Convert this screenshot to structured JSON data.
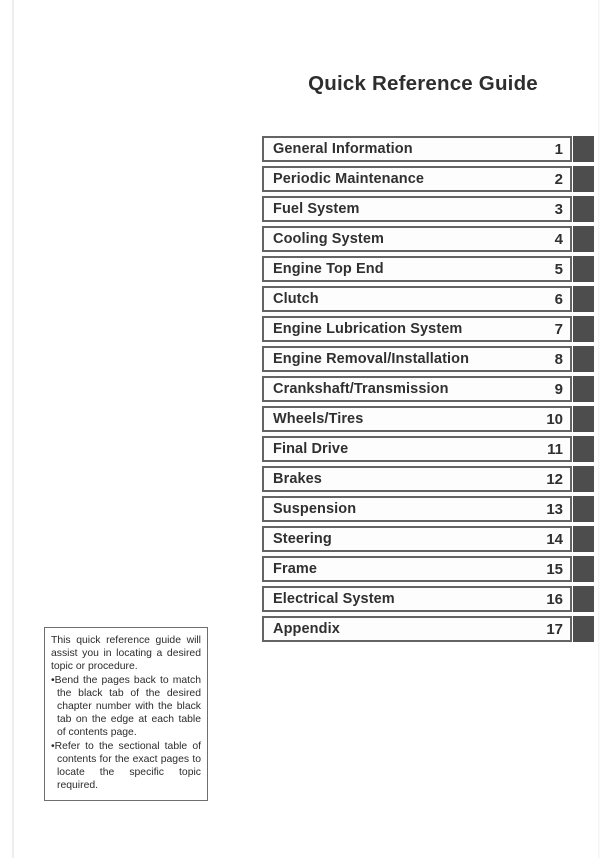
{
  "page": {
    "title": "Quick Reference Guide"
  },
  "chapters": [
    {
      "label": "General Information",
      "number": "1"
    },
    {
      "label": "Periodic Maintenance",
      "number": "2"
    },
    {
      "label": "Fuel System",
      "number": "3"
    },
    {
      "label": "Cooling System",
      "number": "4"
    },
    {
      "label": "Engine Top End",
      "number": "5"
    },
    {
      "label": "Clutch",
      "number": "6"
    },
    {
      "label": "Engine Lubrication System",
      "number": "7"
    },
    {
      "label": "Engine Removal/Installation",
      "number": "8"
    },
    {
      "label": "Crankshaft/Transmission",
      "number": "9"
    },
    {
      "label": "Wheels/Tires",
      "number": "10"
    },
    {
      "label": "Final Drive",
      "number": "11"
    },
    {
      "label": "Brakes",
      "number": "12"
    },
    {
      "label": "Suspension",
      "number": "13"
    },
    {
      "label": "Steering",
      "number": "14"
    },
    {
      "label": "Frame",
      "number": "15"
    },
    {
      "label": "Electrical System",
      "number": "16"
    },
    {
      "label": "Appendix",
      "number": "17"
    }
  ],
  "note": {
    "intro": "This quick reference guide will assist you in locating a desired topic or procedure.",
    "bullets": [
      "Bend the pages back to match the black tab of the desired chapter number with the black tab on the edge at each table of contents page.",
      "Refer to the sectional table of contents for the exact pages to locate the specific topic required."
    ],
    "bullet_marker": "•"
  },
  "colors": {
    "tab": "#4d4d4d",
    "box_border": "#646464",
    "text": "#303030",
    "page_background": "#ffffff"
  }
}
